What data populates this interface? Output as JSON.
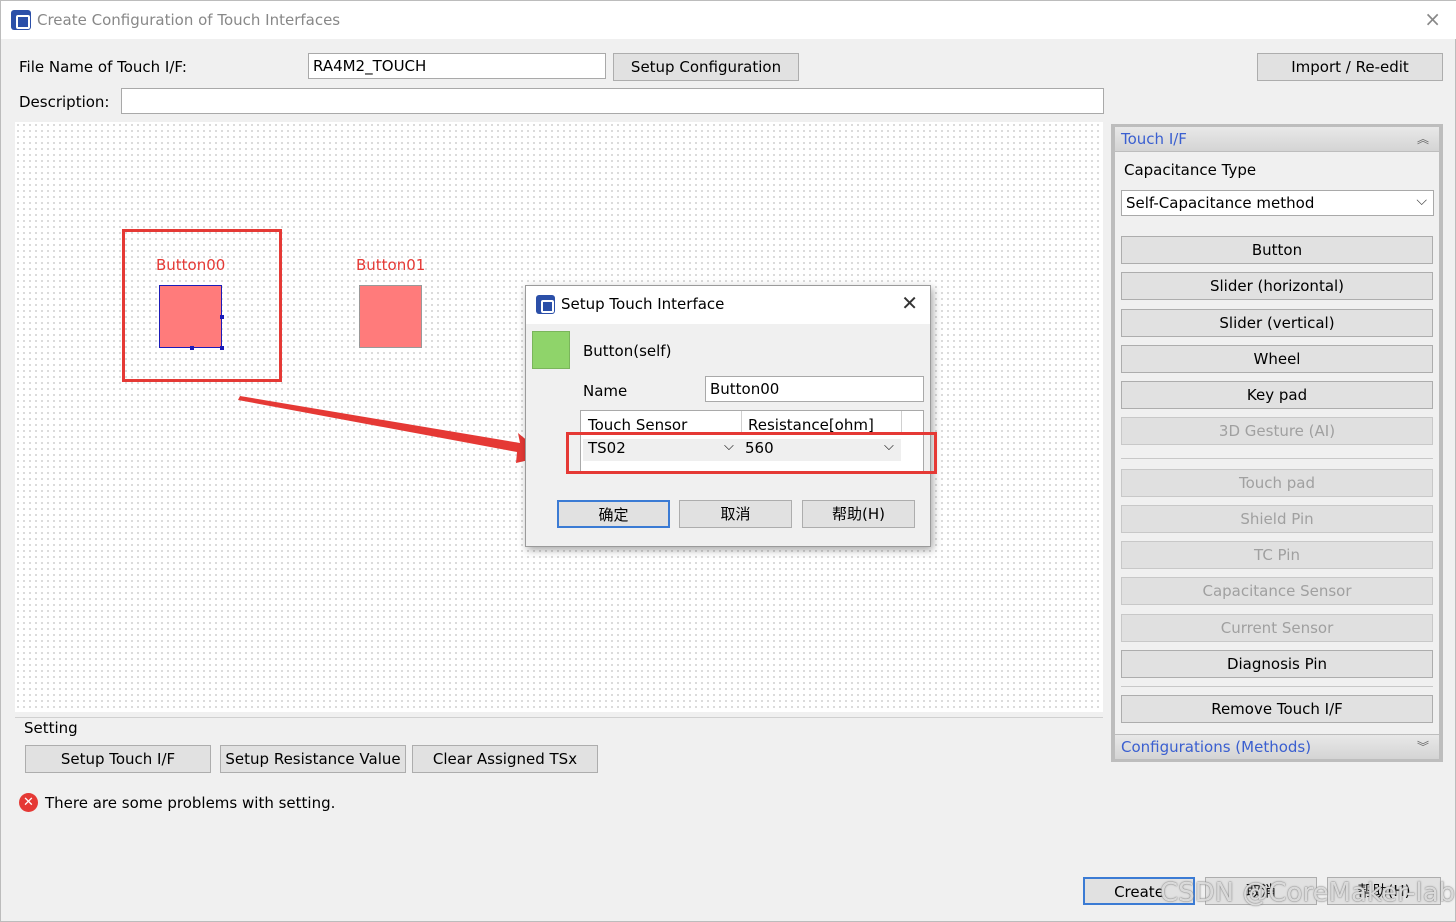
{
  "window": {
    "title": "Create Configuration of Touch Interfaces",
    "close": "×"
  },
  "form": {
    "file_name_label": "File Name of Touch I/F:",
    "file_name_value": "RA4M2_TOUCH",
    "setup_config_label": "Setup Configuration",
    "import_label": "Import / Re-edit",
    "description_label": "Description:",
    "description_value": ""
  },
  "canvas": {
    "buttons": [
      {
        "name": "Button00"
      },
      {
        "name": "Button01"
      }
    ]
  },
  "setting": {
    "group_label": "Setting",
    "setup_touch_if": "Setup Touch I/F",
    "setup_resistance": "Setup Resistance Value",
    "clear_assigned": "Clear Assigned TSx"
  },
  "status": {
    "error_icon": "✕",
    "error_text": "There are some problems with setting."
  },
  "right_panel": {
    "touch_if_header": "Touch I/F",
    "capacitance_label": "Capacitance Type",
    "capacitance_value": "Self-Capacitance method",
    "buttons": [
      {
        "label": "Button",
        "enabled": true
      },
      {
        "label": "Slider (horizontal)",
        "enabled": true
      },
      {
        "label": "Slider (vertical)",
        "enabled": true
      },
      {
        "label": "Wheel",
        "enabled": true
      },
      {
        "label": "Key pad",
        "enabled": true
      },
      {
        "label": "3D Gesture (AI)",
        "enabled": false
      },
      {
        "label": "Touch pad",
        "enabled": false
      },
      {
        "label": "Shield Pin",
        "enabled": false
      },
      {
        "label": "TC Pin",
        "enabled": false
      },
      {
        "label": "Capacitance Sensor",
        "enabled": false
      },
      {
        "label": "Current Sensor",
        "enabled": false
      },
      {
        "label": "Diagnosis Pin",
        "enabled": true
      },
      {
        "label": "Remove Touch I/F",
        "enabled": true
      }
    ],
    "configurations_header": "Configurations (Methods)",
    "chev_up": "︽",
    "chev_down": "︾"
  },
  "dialog": {
    "title": "Setup Touch Interface",
    "close": "✕",
    "type_label": "Button(self)",
    "name_label": "Name",
    "name_value": "Button00",
    "col_touch_sensor": "Touch Sensor",
    "col_resistance": "Resistance[ohm]",
    "row_sensor": "TS02",
    "row_resistance": "560",
    "ok": "确定",
    "cancel": "取消",
    "help": "帮助(H)"
  },
  "footer": {
    "create": "Create",
    "cancel": "取消",
    "help": "帮助(H)",
    "watermark": "CSDN @CoreMaker-lab"
  },
  "colors": {
    "highlight_red": "#e53935",
    "button_fill": "#ff7b7b",
    "selected_border": "#1b1bb8",
    "link_blue": "#3a5fd0"
  }
}
